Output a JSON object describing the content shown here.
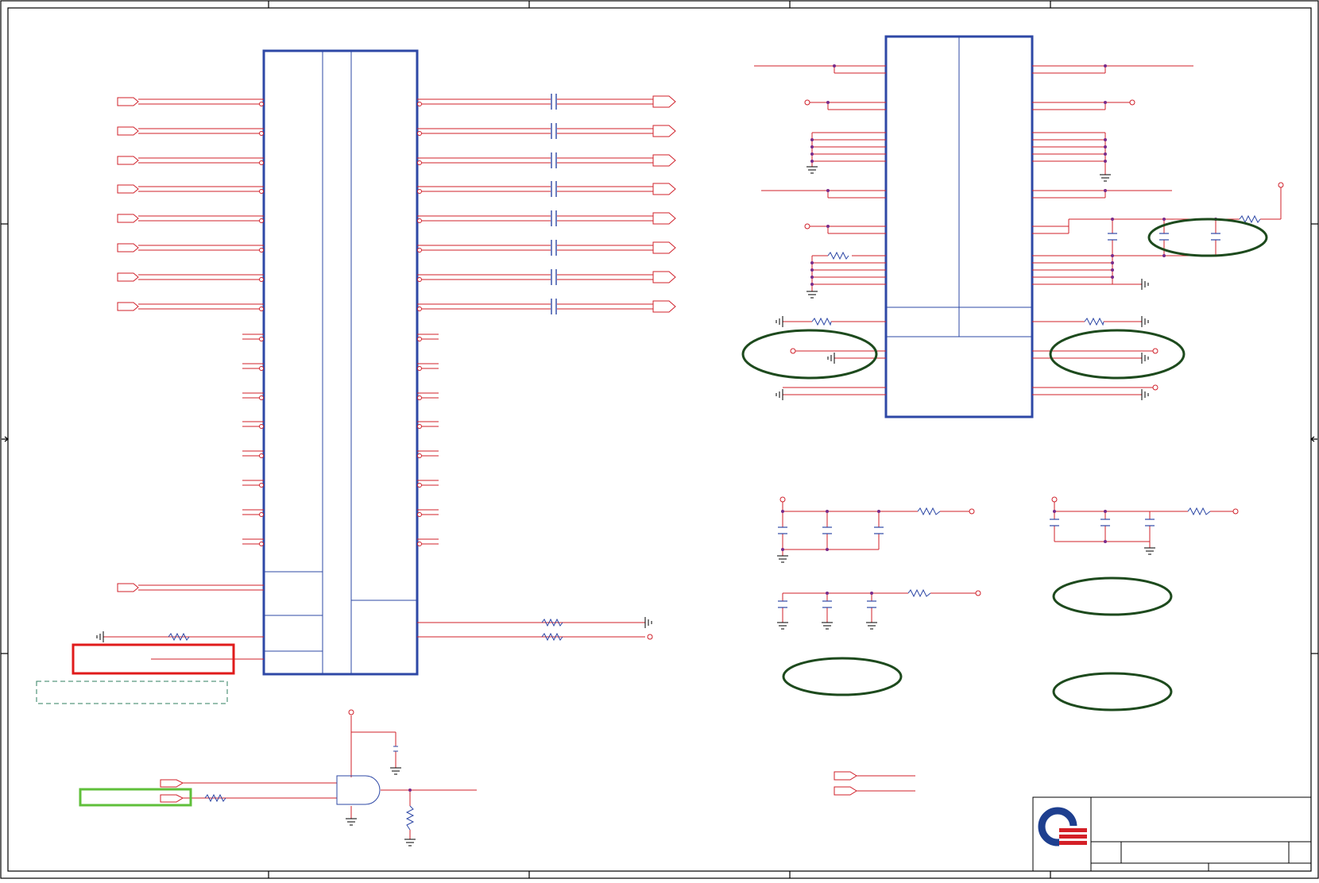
{
  "title": "",
  "colors": {
    "border": "#000000",
    "wire": "#d0202a",
    "component": "#2e48a6",
    "net_node": "#7a2a8a",
    "highlight_ellipse": "#1d4a1d",
    "callout_red": "#e01b1b",
    "callout_green": "#5fbf3a",
    "callout_dashed": "#2f7f5f",
    "logo_blue": "#1e3f8f",
    "logo_red": "#d42027"
  },
  "icons": {
    "logo": "company-logo-icon",
    "ground": "ground-icon",
    "connector": "off-page-connector-icon",
    "capacitor": "capacitor-icon",
    "resistor": "resistor-icon",
    "and_gate": "and-gate-icon"
  },
  "title_block": {
    "title": "",
    "document_number": "",
    "revision": "",
    "sheet": ""
  }
}
